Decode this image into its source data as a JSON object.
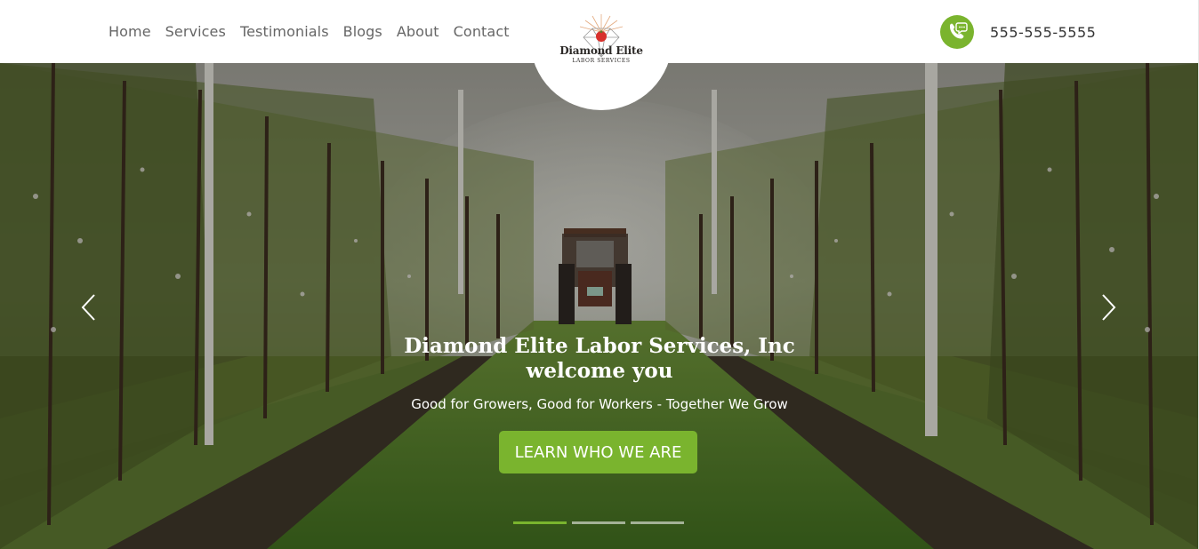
{
  "nav": {
    "items": [
      {
        "label": "Home"
      },
      {
        "label": "Services"
      },
      {
        "label": "Testimonials"
      },
      {
        "label": "Blogs"
      },
      {
        "label": "About"
      },
      {
        "label": "Contact"
      }
    ]
  },
  "logo": {
    "title": "Diamond Elite",
    "subtitle": "LABOR SERVICES"
  },
  "contact": {
    "phone": "555-555-5555",
    "icon": "phone-chat-icon"
  },
  "hero": {
    "title_line1": "Diamond Elite Labor Services, Inc",
    "title_line2": "welcome you",
    "subtitle": "Good for Growers, Good for Workers - Together We Grow",
    "cta_label": "LEARN WHO WE ARE",
    "prev_icon": "chevron-left-icon",
    "next_icon": "chevron-right-icon",
    "slides": 3,
    "active_slide": 1
  },
  "colors": {
    "accent": "#7ab42e",
    "nav_text": "#666666",
    "phone_text": "#333333"
  }
}
